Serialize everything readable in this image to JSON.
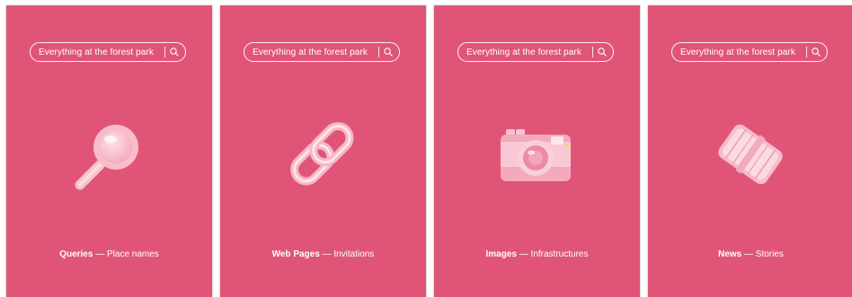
{
  "search": {
    "query": "Everything at the forest park"
  },
  "cards": [
    {
      "label": "Queries",
      "sep": "—",
      "sub": "Place names",
      "icon": "magnifier-icon"
    },
    {
      "label": "Web Pages",
      "sep": "—",
      "sub": "Invitations",
      "icon": "chain-link-icon"
    },
    {
      "label": "Images",
      "sep": "—",
      "sub": "Infrastructures",
      "icon": "camera-icon"
    },
    {
      "label": "News",
      "sep": "—",
      "sub": "Stories",
      "icon": "newspaper-roll-icon"
    }
  ],
  "colors": {
    "card": "#e05577",
    "text": "#ffffff"
  }
}
